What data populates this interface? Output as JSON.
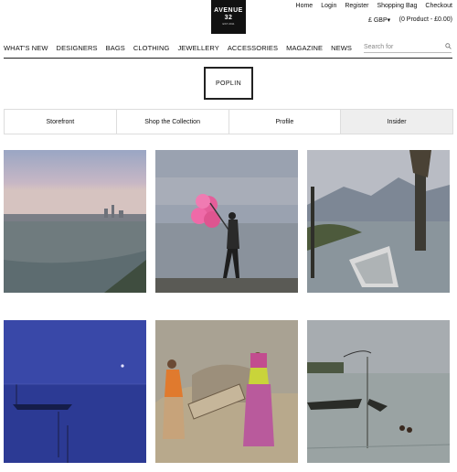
{
  "logo": {
    "line1": "AVENUE",
    "line2": "32",
    "line3": "EST 2011"
  },
  "top_links": [
    "Home",
    "Login",
    "Register",
    "Shopping Bag",
    "Checkout"
  ],
  "currency": "£ GBP▾",
  "cart": "(0 Product - £0.00)",
  "nav": [
    "WHAT'S NEW",
    "DESIGNERS",
    "BAGS",
    "CLOTHING",
    "JEWELLERY",
    "ACCESSORIES",
    "MAGAZINE",
    "NEWS"
  ],
  "search": {
    "placeholder": "Search for"
  },
  "brand": "POPLIN",
  "tabs": [
    "Storefront",
    "Shop the Collection",
    "Profile",
    "Insider"
  ],
  "colors": {
    "accent": "#111111",
    "active_tab": "#eeeeee"
  },
  "gallery": [
    "city-waterfront",
    "cotton-candy-seller",
    "boat-lake-mountains",
    "blue-dusk-lake",
    "women-sifting-grain",
    "lake-boats-evening"
  ]
}
